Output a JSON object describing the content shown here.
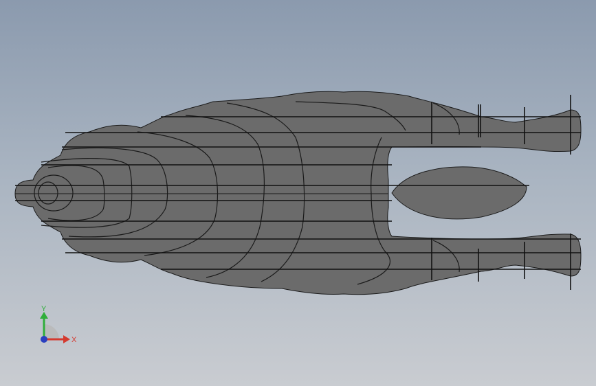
{
  "triad": {
    "y_label": "Y",
    "x_label": "X",
    "y_color": "#2fae3a",
    "x_color": "#d43a2f",
    "z_color": "#2a3fbf"
  },
  "model": {
    "fill_color": "#6b6b6b",
    "edge_color": "#1a1a1a"
  }
}
